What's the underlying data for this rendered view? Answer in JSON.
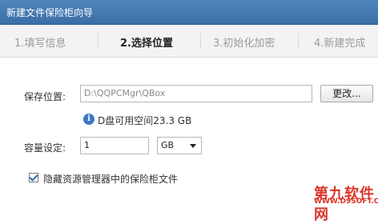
{
  "window": {
    "title": "新建文件保险柜向导"
  },
  "steps": [
    {
      "label": "1.填写信息"
    },
    {
      "label": "2.选择位置"
    },
    {
      "label": "3.初始化加密"
    },
    {
      "label": "4.新建完成"
    }
  ],
  "save_location": {
    "label": "保存位置:",
    "value": "D:\\QQPCMgr\\QBox",
    "button": "更改..."
  },
  "disk_info": {
    "icon": "info-icon",
    "text": "D盘可用空间23.3 GB"
  },
  "capacity": {
    "label": "容量设定:",
    "value": "1",
    "unit_selected": "GB"
  },
  "hide_option": {
    "checked": true,
    "label": "隐藏资源管理器中的保险柜文件"
  },
  "watermark": {
    "text": "第九软件网",
    "url": "WWW.D9SOFT.COM"
  },
  "colors": {
    "titlebar": "#3a6ea6",
    "accent": "#3a79c8",
    "watermark": "#d9362b"
  }
}
